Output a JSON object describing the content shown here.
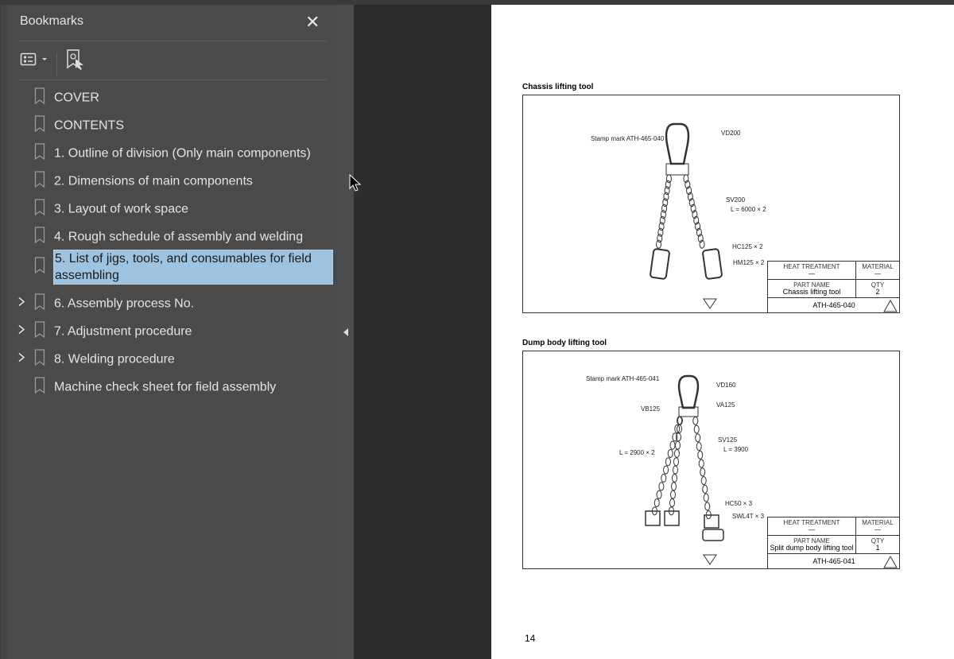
{
  "panel": {
    "title": "Bookmarks",
    "close_icon": "close-icon",
    "toolbar": {
      "options_icon": "list-options-icon",
      "expand_icon": "bookmark-find-current-icon"
    },
    "items": [
      {
        "label": "COVER",
        "expandable": false,
        "selected": false
      },
      {
        "label": "CONTENTS",
        "expandable": false,
        "selected": false
      },
      {
        "label": "1. Outline of division (Only main components)",
        "expandable": false,
        "selected": false
      },
      {
        "label": "2. Dimensions of main components",
        "expandable": false,
        "selected": false
      },
      {
        "label": "3. Layout of work space",
        "expandable": false,
        "selected": false
      },
      {
        "label": "4. Rough schedule of assembly and welding",
        "expandable": false,
        "selected": false
      },
      {
        "label": "5. List of jigs, tools, and consumables for field assembling",
        "expandable": false,
        "selected": true
      },
      {
        "label": "6. Assembly process No.",
        "expandable": true,
        "selected": false
      },
      {
        "label": "7. Adjustment procedure",
        "expandable": true,
        "selected": false
      },
      {
        "label": "8. Welding procedure",
        "expandable": true,
        "selected": false
      },
      {
        "label": "Machine check sheet for field assembly",
        "expandable": false,
        "selected": false
      }
    ],
    "selection_color": "#9ec3e0"
  },
  "document": {
    "page_number": "14",
    "figures": [
      {
        "title": "Chassis lifting tool",
        "labels": {
          "stamp": "Stamp mark  ATH-465-040",
          "a": "VD200",
          "b": "SV200",
          "c": "L = 6000 × 2",
          "d": "HC125 × 2",
          "e": "HM125 × 2"
        },
        "table": {
          "heat_h": "HEAT TREATMENT",
          "heat_v": "—",
          "mat_h": "MATERIAL",
          "mat_v": "—",
          "part_h": "PART NAME",
          "part_v": "Chassis lifting tool",
          "qty_h": "QTY",
          "qty_v": "2",
          "code": "ATH-465-040"
        }
      },
      {
        "title": "Dump body lifting tool",
        "labels": {
          "stamp": "Stamp mark  ATH-465-041",
          "a": "VD160",
          "b": "VB125",
          "c": "VA125",
          "d": "SV125",
          "e": "L = 3900",
          "f": "L = 2900 × 2",
          "g": "HC50 × 3",
          "h": "SWL4T × 3"
        },
        "table": {
          "heat_h": "HEAT TREATMENT",
          "heat_v": "—",
          "mat_h": "MATERIAL",
          "mat_v": "—",
          "part_h": "PART NAME",
          "part_v": "Split dump body lifting tool",
          "qty_h": "QTY",
          "qty_v": "1",
          "code": "ATH-465-041"
        }
      }
    ]
  }
}
